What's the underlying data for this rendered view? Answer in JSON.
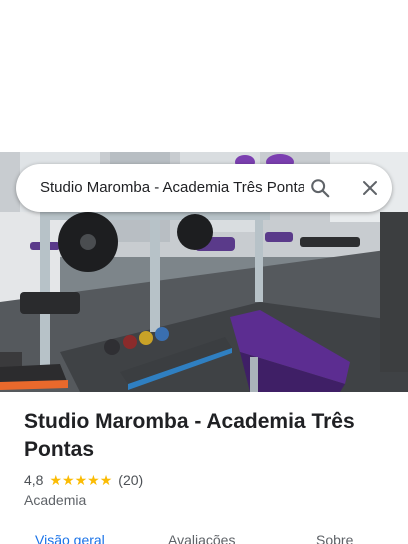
{
  "search": {
    "query": "Studio Maromba - Academia Três Pontas"
  },
  "place": {
    "title": "Studio Maromba - Academia Três Pontas",
    "rating": "4,8",
    "stars": 5,
    "review_count": "(20)",
    "category": "Academia"
  },
  "tabs": [
    {
      "label": "Visão geral"
    },
    {
      "label": "Avaliações"
    },
    {
      "label": "Sobre"
    }
  ],
  "icons": {
    "search": "search-icon",
    "close": "close-icon"
  },
  "colors": {
    "accent": "#1a73e8",
    "star": "#fbbc04",
    "equipment_purple": "#6b3fa0"
  }
}
